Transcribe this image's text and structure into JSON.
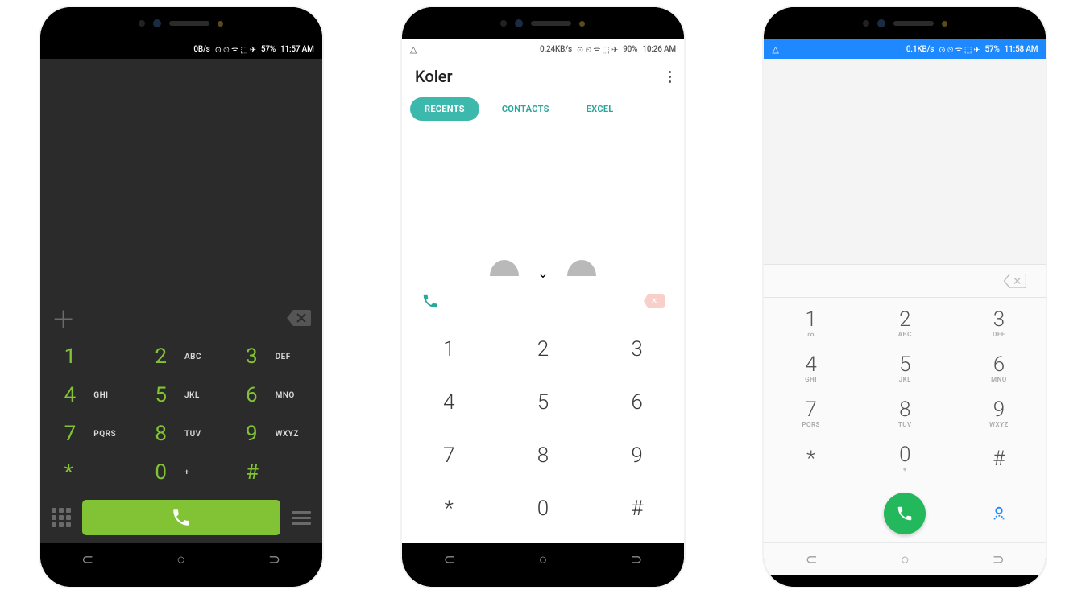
{
  "phone1": {
    "status": {
      "net": "0B/s",
      "icons": "⊙ ⏲ ᯤ ⬚ ✈",
      "battery": "57%",
      "time": "11:57 AM"
    },
    "keys": [
      {
        "d": "1",
        "l": ""
      },
      {
        "d": "2",
        "l": "ABC"
      },
      {
        "d": "3",
        "l": "DEF"
      },
      {
        "d": "4",
        "l": "GHI"
      },
      {
        "d": "5",
        "l": "JKL"
      },
      {
        "d": "6",
        "l": "MNO"
      },
      {
        "d": "7",
        "l": "PQRS"
      },
      {
        "d": "8",
        "l": "TUV"
      },
      {
        "d": "9",
        "l": "WXYZ"
      },
      {
        "d": "*",
        "l": ""
      },
      {
        "d": "0",
        "l": "+"
      },
      {
        "d": "#",
        "l": ""
      }
    ]
  },
  "phone2": {
    "status": {
      "net": "0.24KB/s",
      "icons": "⊙ ⏲ ᯤ ⬚ ✈",
      "battery": "90%",
      "time": "10:26 AM"
    },
    "title": "Koler",
    "tabs": {
      "recents": "RECENTS",
      "contacts": "CONTACTS",
      "excel": "EXCEL"
    },
    "keys": [
      "1",
      "2",
      "3",
      "4",
      "5",
      "6",
      "7",
      "8",
      "9",
      "*",
      "0",
      "#"
    ]
  },
  "phone3": {
    "status": {
      "net": "0.1KB/s",
      "icons": "⊙ ⏲ ᯤ ⬚ ✈",
      "battery": "57%",
      "time": "11:58 AM"
    },
    "keys": [
      {
        "d": "1",
        "l": "∞"
      },
      {
        "d": "2",
        "l": "ABC"
      },
      {
        "d": "3",
        "l": "DEF"
      },
      {
        "d": "4",
        "l": "GHI"
      },
      {
        "d": "5",
        "l": "JKL"
      },
      {
        "d": "6",
        "l": "MNO"
      },
      {
        "d": "7",
        "l": "PQRS"
      },
      {
        "d": "8",
        "l": "TUV"
      },
      {
        "d": "9",
        "l": "WXYZ"
      },
      {
        "d": "*",
        "l": ""
      },
      {
        "d": "0",
        "l": "+"
      },
      {
        "d": "#",
        "l": ""
      }
    ]
  }
}
